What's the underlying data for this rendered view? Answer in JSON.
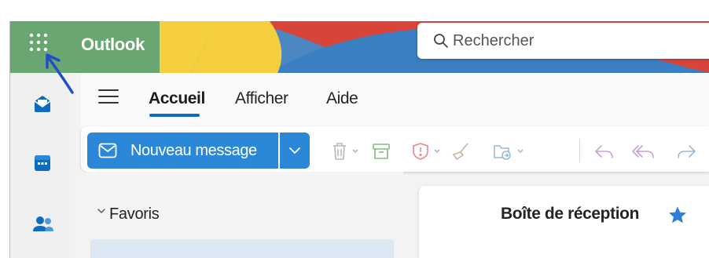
{
  "header": {
    "app_name": "Outlook",
    "search_placeholder": "Rechercher",
    "banner_colors": [
      "#6aa672",
      "#f5cf3d",
      "#e94d3e",
      "#4a87c3"
    ]
  },
  "rail": {
    "items": [
      {
        "name": "mail",
        "icon": "mail-icon"
      },
      {
        "name": "calendar",
        "icon": "calendar-icon"
      },
      {
        "name": "people",
        "icon": "people-icon"
      }
    ]
  },
  "ribbon": {
    "tabs": [
      {
        "label": "Accueil",
        "active": true
      },
      {
        "label": "Afficher",
        "active": false
      },
      {
        "label": "Aide",
        "active": false
      }
    ],
    "new_message_label": "Nouveau message",
    "toolbar_icons": [
      "trash-icon",
      "archive-icon",
      "report-icon",
      "sweep-icon",
      "move-to-icon",
      "reply-icon",
      "reply-all-icon",
      "forward-icon"
    ]
  },
  "folders": {
    "favorites_label": "Favoris"
  },
  "message_list": {
    "title": "Boîte de réception"
  },
  "colors": {
    "accent": "#0f6cbd",
    "new_message_bg": "#2b88d8",
    "annotation_arrow": "#1f4fc7"
  }
}
